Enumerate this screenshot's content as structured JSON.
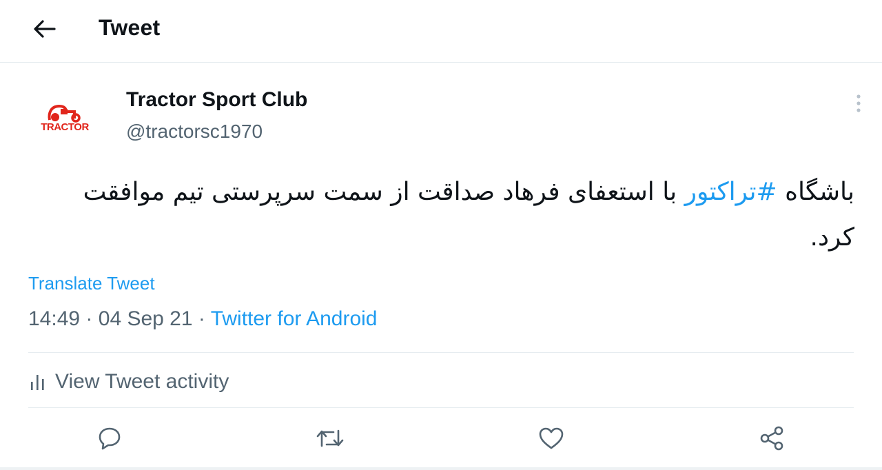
{
  "header": {
    "title": "Tweet",
    "back_icon": "arrow-left-icon"
  },
  "author": {
    "display_name": "Tractor Sport Club",
    "handle": "@tractorsc1970",
    "avatar_text": "TRACTOR",
    "brand_color": "#e1261c"
  },
  "tweet": {
    "text_before": "باشگاه ",
    "hashtag": "#تراکتور",
    "text_after": " با استعفای فرهاد صداقت از سمت سرپرستی تیم موافقت کرد.",
    "translate_label": "Translate Tweet",
    "time": "14:49",
    "separator": "·",
    "date": "04 Sep 21",
    "source": "Twitter for Android"
  },
  "activity": {
    "label": "View Tweet activity",
    "icon": "bar-chart-icon"
  },
  "actions": [
    {
      "icon": "reply-icon"
    },
    {
      "icon": "retweet-icon"
    },
    {
      "icon": "like-icon"
    },
    {
      "icon": "share-icon"
    }
  ],
  "colors": {
    "accent": "#1d9bf0",
    "secondary_text": "#536471",
    "divider": "#e6ecf0"
  }
}
